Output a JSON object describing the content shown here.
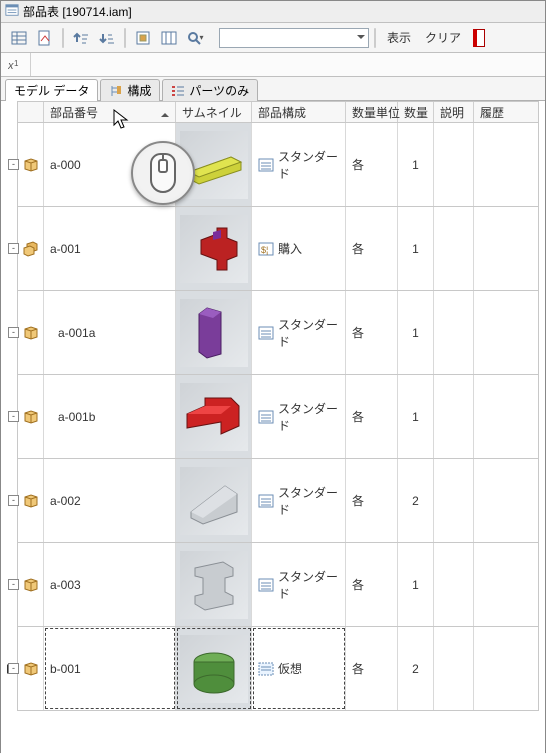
{
  "window": {
    "title": "部品表 [190714.iam]"
  },
  "toolbar": {
    "display_label": "表示",
    "clear_label": "クリア"
  },
  "tabs": {
    "model_data": "モデル データ",
    "structure": "構成",
    "parts_only": "パーツのみ"
  },
  "columns": {
    "part_no": "部品番号",
    "thumbnail": "サムネイル",
    "composition": "部品構成",
    "unit": "数量単位",
    "qty": "数量",
    "desc": "説明",
    "history": "履歴"
  },
  "comp_labels": {
    "standard": "スタンダード",
    "purchase": "購入",
    "virtual": "仮想"
  },
  "unit_each": "各",
  "rows": [
    {
      "part": "a-000",
      "level": 0,
      "exp": "-",
      "comp": "standard",
      "unit_key": "unit_each",
      "qty": "1",
      "thumb": "yellow-bar",
      "asm": false
    },
    {
      "part": "a-001",
      "level": 0,
      "exp": "-",
      "comp": "purchase",
      "unit_key": "unit_each",
      "qty": "1",
      "thumb": "red-cross",
      "asm": true
    },
    {
      "part": "a-001a",
      "level": 1,
      "exp": "-",
      "comp": "standard",
      "unit_key": "unit_each",
      "qty": "1",
      "thumb": "purple-box",
      "asm": false
    },
    {
      "part": "a-001b",
      "level": 1,
      "exp": "-",
      "comp": "standard",
      "unit_key": "unit_each",
      "qty": "1",
      "thumb": "red-l",
      "asm": false
    },
    {
      "part": "a-002",
      "level": 0,
      "exp": "-",
      "comp": "standard",
      "unit_key": "unit_each",
      "qty": "2",
      "thumb": "gray-wedge",
      "asm": false
    },
    {
      "part": "a-003",
      "level": 0,
      "exp": "-",
      "comp": "standard",
      "unit_key": "unit_each",
      "qty": "1",
      "thumb": "gray-ibeam",
      "asm": false
    },
    {
      "part": "b-001",
      "level": 0,
      "exp": "-",
      "comp": "virtual",
      "unit_key": "unit_each",
      "qty": "2",
      "thumb": "green-cyl",
      "asm": false,
      "selected": true
    }
  ]
}
